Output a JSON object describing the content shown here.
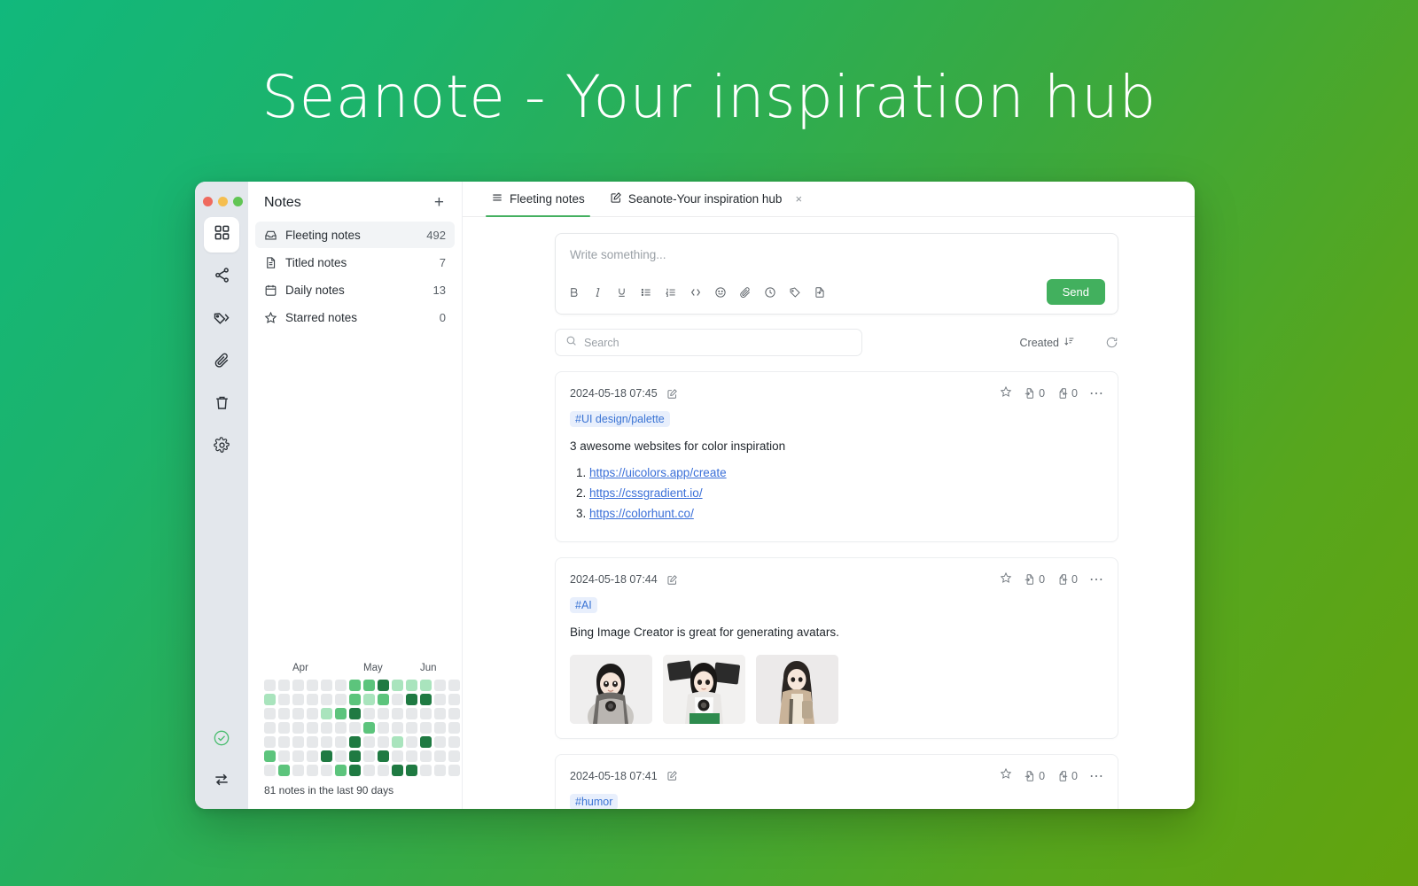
{
  "hero": {
    "title": "Seanote - Your inspiration hub"
  },
  "theme": {
    "gradient_start": "#11b87c",
    "gradient_end": "#63a30d",
    "accent_green": "#42b05e",
    "tag_blue": "#3b74d4",
    "link_blue": "#3a6fd8"
  },
  "window": {
    "traffic_lights": [
      "close",
      "minimize",
      "zoom"
    ]
  },
  "icon_rail": {
    "items": [
      {
        "name": "grid-icon",
        "label": "Dashboard",
        "active": true
      },
      {
        "name": "share-nodes-icon",
        "label": "Graph",
        "active": false
      },
      {
        "name": "tags-icon",
        "label": "Tags",
        "active": false
      },
      {
        "name": "paperclip-icon",
        "label": "Attachments",
        "active": false
      },
      {
        "name": "trash-icon",
        "label": "Trash",
        "active": false
      },
      {
        "name": "gear-icon",
        "label": "Settings",
        "active": false
      }
    ],
    "bottom_items": [
      {
        "name": "check-circle-icon",
        "label": "Synced"
      },
      {
        "name": "sync-arrows-icon",
        "label": "Sync"
      }
    ]
  },
  "sidebar": {
    "title": "Notes",
    "add_label": "+",
    "items": [
      {
        "icon": "inbox-icon",
        "label": "Fleeting notes",
        "count": "492",
        "active": true
      },
      {
        "icon": "document-icon",
        "label": "Titled notes",
        "count": "7",
        "active": false
      },
      {
        "icon": "calendar-icon",
        "label": "Daily notes",
        "count": "13",
        "active": false
      },
      {
        "icon": "star-icon",
        "label": "Starred notes",
        "count": "0",
        "active": false
      }
    ],
    "heatmap": {
      "month_labels": [
        {
          "text": "Apr",
          "col": 2
        },
        {
          "text": "May",
          "col": 7
        },
        {
          "text": "Jun",
          "col": 11
        }
      ],
      "caption": "81 notes in the last 90 days",
      "columns": 14,
      "rows": 7,
      "levels": [
        [
          0,
          0,
          0,
          0,
          0,
          0,
          3,
          3,
          4,
          2,
          2,
          2,
          0,
          0
        ],
        [
          2,
          0,
          0,
          0,
          0,
          0,
          3,
          2,
          3,
          0,
          4,
          4,
          0,
          0
        ],
        [
          0,
          0,
          0,
          0,
          2,
          3,
          4,
          0,
          0,
          0,
          1,
          0,
          0,
          0
        ],
        [
          0,
          0,
          0,
          0,
          0,
          0,
          0,
          3,
          0,
          0,
          0,
          0,
          0,
          0
        ],
        [
          0,
          0,
          0,
          0,
          0,
          0,
          4,
          0,
          0,
          2,
          0,
          4,
          0,
          0
        ],
        [
          3,
          0,
          0,
          0,
          4,
          0,
          4,
          0,
          4,
          0,
          0,
          0,
          0,
          0
        ],
        [
          0,
          3,
          0,
          0,
          0,
          3,
          4,
          0,
          0,
          4,
          4,
          0,
          0,
          0
        ]
      ],
      "level_colors": [
        "#e6e8ea",
        "#e6e8ea",
        "#a9e4bd",
        "#5cc47c",
        "#1f7a42"
      ]
    }
  },
  "tabs": [
    {
      "icon": "list-icon",
      "label": "Fleeting notes",
      "active": true,
      "closable": false
    },
    {
      "icon": "edit-square-icon",
      "label": "Seanote-Your inspiration hub",
      "active": false,
      "closable": true,
      "close_label": "×"
    }
  ],
  "editor": {
    "placeholder": "Write something...",
    "send_label": "Send",
    "toolbar": [
      {
        "name": "bold-icon",
        "glyph": "B"
      },
      {
        "name": "italic-icon",
        "glyph": "I"
      },
      {
        "name": "underline-icon",
        "glyph": "U"
      },
      {
        "name": "bullet-list-icon",
        "glyph": ""
      },
      {
        "name": "numbered-list-icon",
        "glyph": ""
      },
      {
        "name": "code-icon",
        "glyph": ""
      },
      {
        "name": "emoji-icon",
        "glyph": ""
      },
      {
        "name": "attachment-icon",
        "glyph": ""
      },
      {
        "name": "clock-icon",
        "glyph": ""
      },
      {
        "name": "tag-icon",
        "glyph": ""
      },
      {
        "name": "insert-file-icon",
        "glyph": ""
      }
    ]
  },
  "search": {
    "placeholder": "Search",
    "sort_label": "Created",
    "sort_icon": "sort-desc-icon",
    "refresh_icon": "refresh-icon"
  },
  "notes": [
    {
      "date": "2024-05-18 07:45",
      "tag": "#UI design/palette",
      "text": "3 awesome websites for color inspiration",
      "links": [
        "https://uicolors.app/create",
        "https://cssgradient.io/",
        "https://colorhunt.co/"
      ],
      "star_count": "",
      "backlink_in": "0",
      "backlink_out": "0",
      "more_label": "⋯"
    },
    {
      "date": "2024-05-18 07:44",
      "tag": "#AI",
      "text": "Bing Image Creator is great for generating avatars.",
      "images": [
        "avatar-thumb-1",
        "avatar-thumb-2",
        "avatar-thumb-3"
      ],
      "backlink_in": "0",
      "backlink_out": "0",
      "more_label": "⋯"
    },
    {
      "date": "2024-05-18 07:41",
      "tag": "#humor",
      "backlink_in": "0",
      "backlink_out": "0",
      "more_label": "⋯"
    }
  ]
}
